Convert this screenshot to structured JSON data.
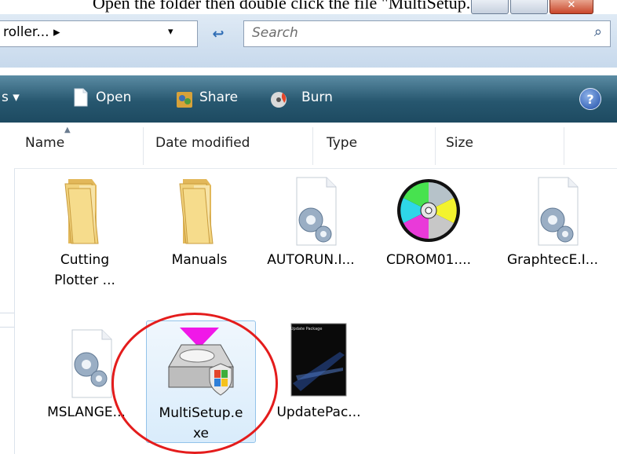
{
  "caption": "Open the folder then double click the file \"MultiSetup.exe\".",
  "address": {
    "path_text": "roller... ▸",
    "dropdown_glyph": "▾",
    "refresh_glyph": "↩"
  },
  "search": {
    "placeholder": "Search",
    "icon": "search-icon"
  },
  "toolbar": {
    "views_label": "s ▾",
    "open_label": "Open",
    "share_label": "Share",
    "burn_label": "Burn",
    "help_label": "?"
  },
  "columns": [
    "Name",
    "Date modified",
    "Type",
    "Size"
  ],
  "files": [
    {
      "label_line1": "Cutting",
      "label_line2": "Plotter ...",
      "icon": "folder-icon"
    },
    {
      "label_line1": "Manuals",
      "label_line2": "",
      "icon": "folder-icon"
    },
    {
      "label_line1": "AUTORUN.I...",
      "label_line2": "",
      "icon": "config-file-icon"
    },
    {
      "label_line1": "CDROM01....",
      "label_line2": "",
      "icon": "disc-icon"
    },
    {
      "label_line1": "GraphtecE.I...",
      "label_line2": "",
      "icon": "config-file-icon"
    },
    {
      "label_line1": "MSLANGE...",
      "label_line2": "",
      "icon": "config-file-icon"
    },
    {
      "label_line1": "MultiSetup.e",
      "label_line2": "xe",
      "icon": "setup-exe-icon",
      "selected": true
    },
    {
      "label_line1": "UpdatePac...",
      "label_line2": "",
      "icon": "update-package-icon"
    }
  ],
  "update_icon_text": "Update Package",
  "colors": {
    "toolbar": "#27576f",
    "highlight_ring": "#e41c1c",
    "selection": "#d9ecfb"
  }
}
